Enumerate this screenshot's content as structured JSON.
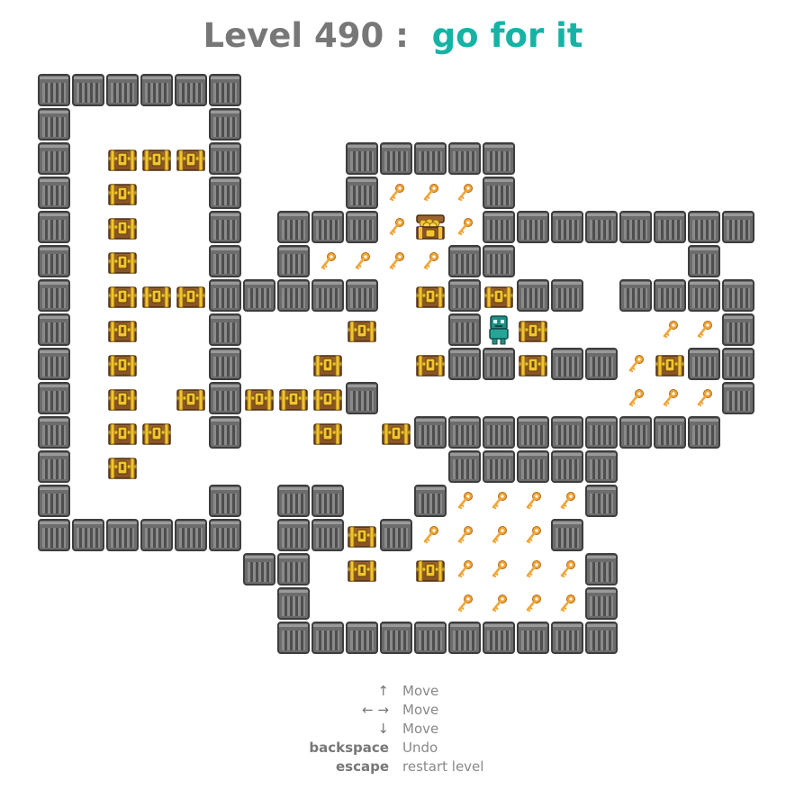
{
  "title": {
    "level": "Level 490",
    "separator": ":",
    "name": "go for it"
  },
  "grid": {
    "cols": 21,
    "rows": 17,
    "map": [
      "######...............",
      "#....#...............",
      "#.CCC#...#####.......",
      "#.C..#...#KKK#.......",
      "#.C..#.###KGK########",
      "#.C..#.#KKKK##.....#.",
      "#.CCC#####.C#C##.####",
      "#.C..#...C..#PC...KK#",
      "#.C..#..C..C##C##KC##",
      "#.C.C#CCC#.......KKK#",
      "#.CC.#..C.C#########.",
      "#.C.........#####....",
      "#....#.##..#KKKK#....",
      "######.##C#KKKK#.....",
      "......##.C.CKKKK#....",
      ".......#....KKKK#....",
      ".......##########...."
    ],
    "legend": {
      "#": "wall",
      "C": "chest",
      "K": "key",
      "G": "gold-chest",
      "P": "player",
      ".": "floor"
    }
  },
  "colors": {
    "title_gray": "#777777",
    "title_teal": "#15b3a5",
    "wall": "#6c6c6c",
    "chest": "#9b6330",
    "gold": "#f3c431",
    "key": "#f0a63a",
    "player": "#1f8f84"
  },
  "controls": [
    {
      "key": "↑",
      "action": "Move",
      "bold": false
    },
    {
      "key": "← →",
      "action": "Move",
      "bold": false
    },
    {
      "key": "↓",
      "action": "Move",
      "bold": false
    },
    {
      "key": "backspace",
      "action": "Undo",
      "bold": true
    },
    {
      "key": "escape",
      "action": "restart level",
      "bold": true
    }
  ]
}
